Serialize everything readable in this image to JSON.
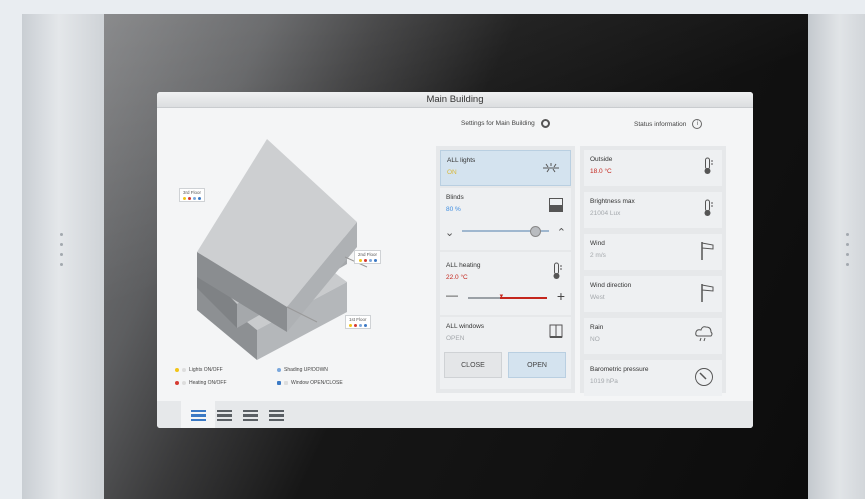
{
  "window": {
    "title": "Main Building"
  },
  "header": {
    "settings_label": "Settings for Main Building",
    "settings_icon": "gear-icon",
    "status_label": "Status information",
    "status_icon": "info-icon"
  },
  "building": {
    "floors": [
      {
        "label": "3rd Floor"
      },
      {
        "label": "2nd Floor"
      },
      {
        "label": "1st Floor"
      }
    ],
    "legend": [
      {
        "label": "Lights ON/OFF",
        "icon": "light-icon"
      },
      {
        "label": "Shading UP/DOWN",
        "icon": "shading-icon"
      },
      {
        "label": "Heating ON/OFF",
        "icon": "heating-icon"
      },
      {
        "label": "Window OPEN/CLOSE",
        "icon": "window-icon"
      }
    ]
  },
  "controls": {
    "lights": {
      "label": "ALL lights",
      "value": "ON",
      "icon": "light-icon"
    },
    "blinds": {
      "label": "Blinds",
      "value": "80 %",
      "icon": "blinds-icon",
      "position": 0.8
    },
    "heating": {
      "label": "ALL heating",
      "value": "22.0 °C",
      "icon": "thermometer-icon"
    },
    "windows": {
      "label": "ALL windows",
      "value": "OPEN",
      "icon": "window-icon"
    },
    "close_button": "CLOSE",
    "open_button": "OPEN"
  },
  "status": [
    {
      "label": "Outside",
      "value": "18.0 °C",
      "icon": "thermometer-icon"
    },
    {
      "label": "Brightness max",
      "value": "21004 Lux",
      "icon": "thermometer-icon"
    },
    {
      "label": "Wind",
      "value": "2 m/s",
      "icon": "wind-flag-icon"
    },
    {
      "label": "Wind direction",
      "value": "West",
      "icon": "wind-flag-icon"
    },
    {
      "label": "Rain",
      "value": "NO",
      "icon": "rain-cloud-icon"
    },
    {
      "label": "Barometric pressure",
      "value": "1019 hPa",
      "icon": "barometer-icon"
    }
  ],
  "nav": {
    "items": [
      {
        "icon": "floor-view-icon",
        "active": true
      },
      {
        "icon": "floor-view-icon",
        "active": false
      },
      {
        "icon": "floor-view-icon",
        "active": false
      },
      {
        "icon": "floor-view-icon",
        "active": false
      }
    ]
  },
  "colors": {
    "accent": "#3b79c4",
    "value_red": "#c4261d",
    "value_blue": "#3d8ce0",
    "tile_active": "#d4e3ef"
  }
}
